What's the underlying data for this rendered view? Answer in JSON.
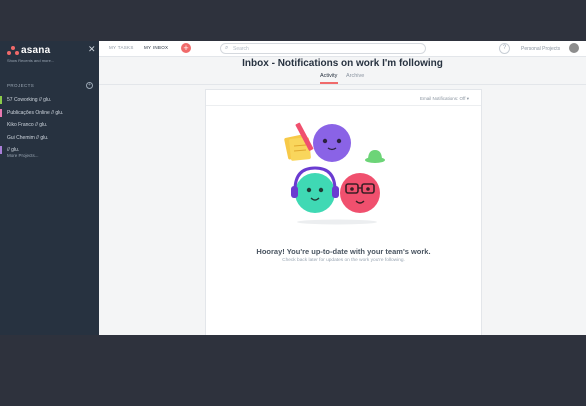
{
  "sidebar": {
    "logo_text": "asana",
    "show_recents": "Show Recents and more...",
    "projects_header": "PROJECTS",
    "projects": [
      {
        "label": "57 Coworking // glu.",
        "color": "#8bcb4a"
      },
      {
        "label": "Publicações Online // glu.",
        "color": "#e879b0"
      },
      {
        "label": "Kiko Franco // glu.",
        "color": ""
      },
      {
        "label": "Gui Chemim // glu.",
        "color": ""
      },
      {
        "label": "// glu.",
        "color": "#a97fd8"
      }
    ],
    "more_projects": "More Projects..."
  },
  "topbar": {
    "my_tasks": "MY TASKS",
    "my_inbox": "MY INBOX",
    "search_placeholder": "Search",
    "workspace": "Personal Projects"
  },
  "header": {
    "title": "Inbox - Notifications on work I'm following",
    "tabs": [
      "Activity",
      "Archive"
    ]
  },
  "panel": {
    "email_notifications": "Email Notifications: Off",
    "empty_title": "Hooray! You're up-to-date with your team's work.",
    "empty_subtitle": "Check back later for updates on the work you're following."
  },
  "colors": {
    "accent": "#f06a6a",
    "sidebar_bg": "#273240",
    "purple": "#8a63e6",
    "teal": "#3fd9b4",
    "red": "#f0506e"
  }
}
